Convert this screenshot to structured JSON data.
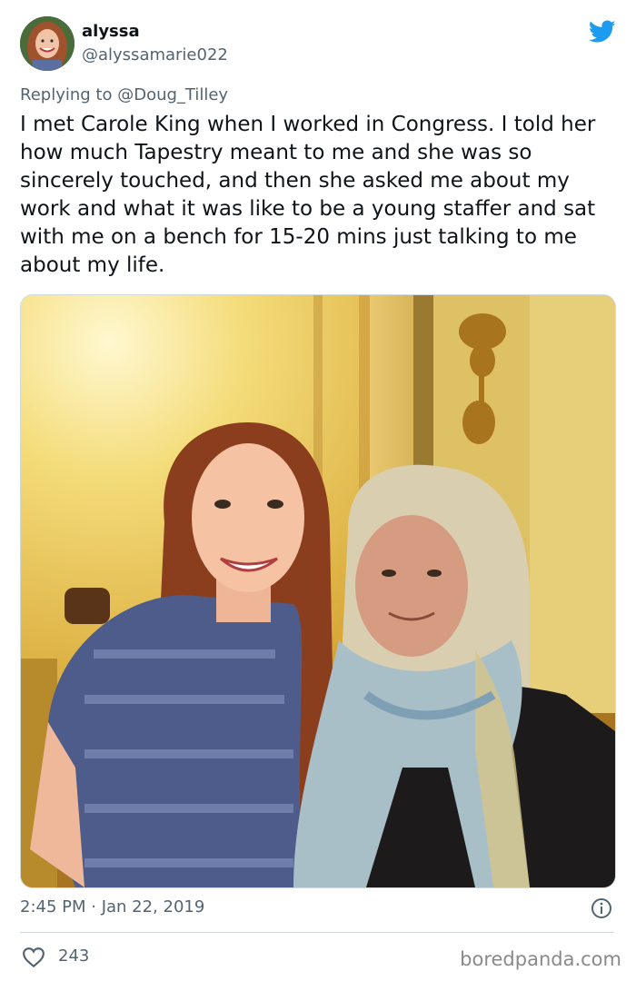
{
  "user": {
    "name": "alyssa",
    "handle": "@alyssamarie022"
  },
  "reply": {
    "prefix": "Replying to ",
    "mention": "@Doug_Tilley"
  },
  "tweet": {
    "text": "I met Carole King when I worked in Congress. I told her how much Tapestry meant to me and she was so sincerely touched, and then she asked me about my work and what it was like to be a young staffer and sat with me on a bench for 15-20 mins just talking to me about my life.",
    "timestamp": "2:45 PM · Jan 22, 2019",
    "like_count": "243"
  },
  "watermark": "boredpanda.com",
  "icons": {
    "brand": "twitter-bird-icon",
    "info": "info-icon",
    "like": "heart-icon"
  },
  "colors": {
    "twitter_blue": "#1d9bf0",
    "secondary_text": "#536471",
    "primary_text": "#0f1419"
  }
}
